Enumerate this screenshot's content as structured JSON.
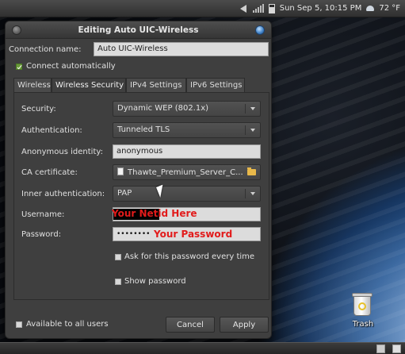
{
  "panel": {
    "clock": "Sun Sep  5, 10:15 PM",
    "temperature": "72 °F"
  },
  "dialog": {
    "title": "Editing Auto UIC-Wireless",
    "connection_name_label": "Connection name:",
    "connection_name_value": "Auto UIC-Wireless",
    "connect_automatically_label": "Connect automatically",
    "connect_automatically_checked": true,
    "tabs": [
      {
        "label": "Wireless",
        "active": false
      },
      {
        "label": "Wireless Security",
        "active": true
      },
      {
        "label": "IPv4 Settings",
        "active": false
      },
      {
        "label": "IPv6 Settings",
        "active": false
      }
    ],
    "security": {
      "security_label": "Security:",
      "security_value": "Dynamic WEP (802.1x)",
      "authentication_label": "Authentication:",
      "authentication_value": "Tunneled TLS",
      "anonymous_identity_label": "Anonymous identity:",
      "anonymous_identity_value": "anonymous",
      "ca_certificate_label": "CA certificate:",
      "ca_certificate_value": "Thawte_Premium_Server_C...",
      "inner_authentication_label": "Inner authentication:",
      "inner_authentication_value": "PAP",
      "username_label": "Username:",
      "username_annotation": "Your Netid Here",
      "password_label": "Password:",
      "password_mask": "••••••••",
      "password_annotation": "Your Password",
      "ask_password_label": "Ask for this password every time",
      "show_password_label": "Show password"
    },
    "available_to_all_label": "Available to all users",
    "cancel_label": "Cancel",
    "apply_label": "Apply"
  },
  "desktop": {
    "trash_label": "Trash"
  },
  "colors": {
    "annotation_red": "#e21b1b",
    "check_green": "#6a9a3a"
  }
}
